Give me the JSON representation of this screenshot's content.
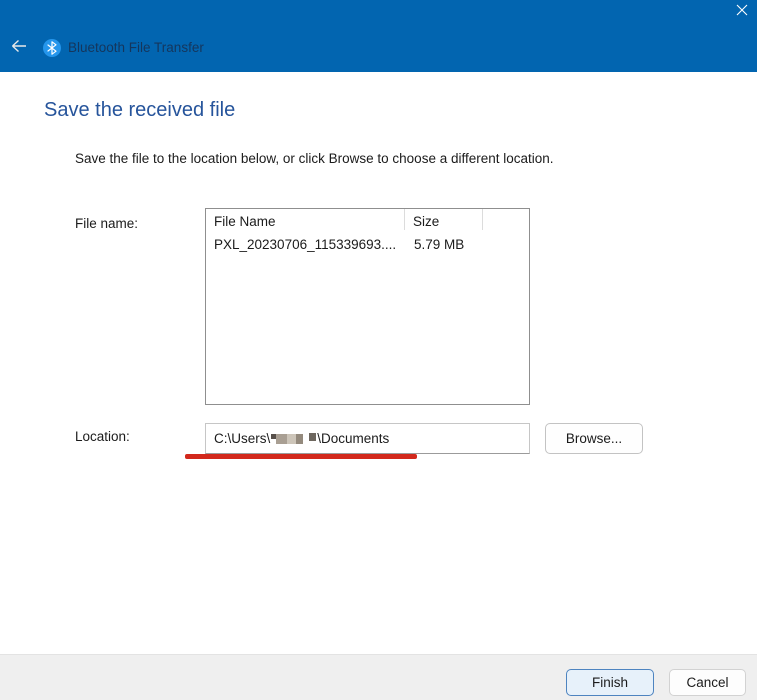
{
  "titlebar": {
    "title": "Bluetooth File Transfer",
    "bg_color": "#0265b0",
    "icons": {
      "back": "arrow-left",
      "app": "bluetooth",
      "close": "close-x"
    }
  },
  "page": {
    "heading": "Save the received file",
    "heading_color": "#26549b",
    "instruction": "Save the file to the location below, or click Browse to choose a different location."
  },
  "file_section": {
    "label": "File name:",
    "columns": [
      "File Name",
      "Size"
    ],
    "rows": [
      {
        "name": "PXL_20230706_115339693....",
        "size": "5.79 MB"
      }
    ]
  },
  "location_section": {
    "label": "Location:",
    "path_prefix": "C:\\Users\\",
    "path_redacted": "username-redacted",
    "path_suffix": "\\Documents",
    "browse_label": "Browse..."
  },
  "annotation": {
    "type": "red-underline",
    "color": "#d2281c"
  },
  "footer": {
    "finish_label": "Finish",
    "cancel_label": "Cancel"
  }
}
